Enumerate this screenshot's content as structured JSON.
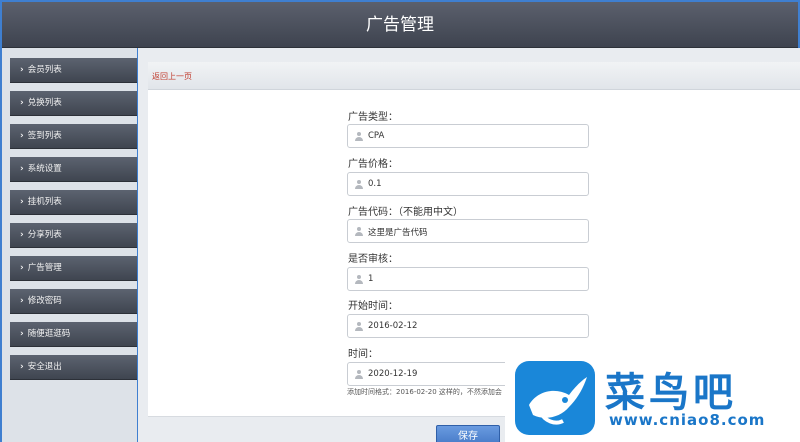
{
  "header": {
    "title": "广告管理"
  },
  "sidebar": {
    "items": [
      {
        "label": "会员列表"
      },
      {
        "label": "兑换列表"
      },
      {
        "label": "签到列表"
      },
      {
        "label": "系统设置"
      },
      {
        "label": "挂机列表"
      },
      {
        "label": "分享列表"
      },
      {
        "label": "广告管理"
      },
      {
        "label": "修改密码"
      },
      {
        "label": "随便逛逛码"
      },
      {
        "label": "安全退出"
      }
    ]
  },
  "main": {
    "back_link": "返回上一页",
    "fields": [
      {
        "label": "广告类型：",
        "value": "CPA"
      },
      {
        "label": "广告价格：",
        "value": "0.1"
      },
      {
        "label": "广告代码：（不能用中文）",
        "value": "这里是广告代码"
      },
      {
        "label": "是否审核：",
        "value": "1"
      },
      {
        "label": "开始时间：",
        "value": "2016-02-12"
      },
      {
        "label": "时间：",
        "value": "2020-12-19"
      }
    ],
    "hint": "添加时间格式：2016-02-20 这样的，不然添加会",
    "save_label": "保存"
  },
  "watermark": {
    "title": "菜鸟吧",
    "url": "www.cniao8.com"
  }
}
